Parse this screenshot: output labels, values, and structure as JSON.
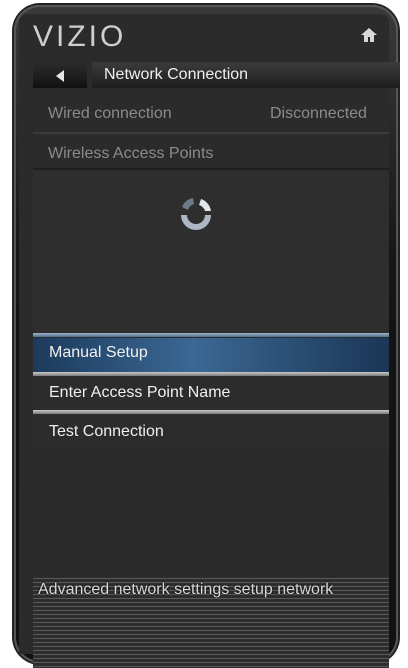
{
  "app": {
    "logo": "VIZIO",
    "home_icon": "home-icon"
  },
  "header": {
    "title": "Network Connection",
    "back_icon": "back-arrow-icon"
  },
  "wired": {
    "label": "Wired connection",
    "status": "Disconnected"
  },
  "wireless": {
    "label": "Wireless Access Points",
    "loading_icon": "loading-spinner-icon"
  },
  "menu": {
    "items": [
      {
        "label": "Manual Setup",
        "selected": true
      },
      {
        "label": "Enter Access Point Name",
        "selected": false
      },
      {
        "label": "Test Connection",
        "selected": false
      }
    ]
  },
  "footer": {
    "hint": "Advanced network settings setup network"
  },
  "colors": {
    "selection": "#3b6894",
    "panel": "#2b2b2b",
    "text_dim": "#8b8b8b"
  }
}
